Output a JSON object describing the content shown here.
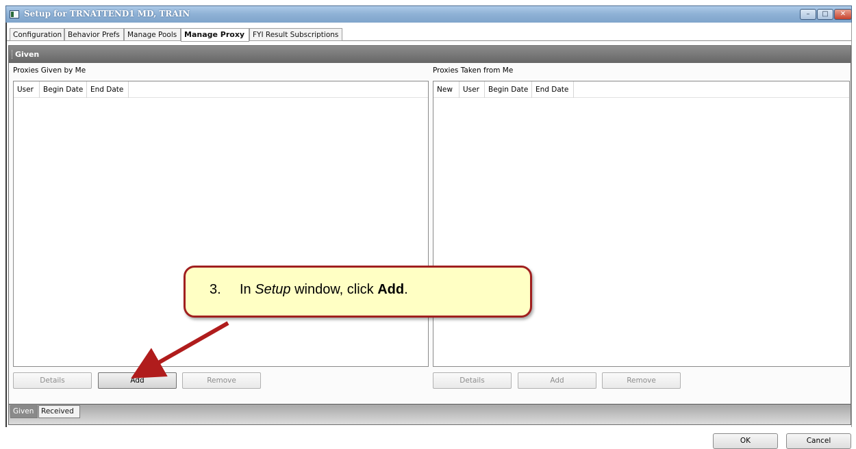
{
  "window": {
    "title": "Setup for TRNATTEND1 MD, TRAIN",
    "min_glyph": "–",
    "max_glyph": "□",
    "close_glyph": "✕"
  },
  "tabs": [
    {
      "label": "Configuration",
      "active": false
    },
    {
      "label": "Behavior Prefs",
      "active": false
    },
    {
      "label": "Manage Pools",
      "active": false
    },
    {
      "label": "Manage Proxy",
      "active": true
    },
    {
      "label": "FYI Result Subscriptions",
      "active": false
    }
  ],
  "section": {
    "title": "Given"
  },
  "given_pane": {
    "label": "Proxies Given by Me",
    "columns": [
      "User",
      "Begin Date",
      "End Date"
    ],
    "rows": [],
    "buttons": {
      "details": "Details",
      "add": "Add",
      "remove": "Remove"
    }
  },
  "taken_pane": {
    "label": "Proxies Taken from Me",
    "columns": [
      "New",
      "User",
      "Begin Date",
      "End Date"
    ],
    "rows": [],
    "buttons": {
      "details": "Details",
      "add": "Add",
      "remove": "Remove"
    }
  },
  "bottom_tabs": [
    {
      "label": "Given",
      "active": true
    },
    {
      "label": "Received",
      "active": false
    }
  ],
  "dialog": {
    "ok": "OK",
    "cancel": "Cancel"
  },
  "callout": {
    "number": "3.",
    "text_before": "In ",
    "italic": "Setup",
    "text_middle": " window, click ",
    "bold": "Add",
    "text_after": "."
  },
  "colors": {
    "callout_border": "#a01f1f",
    "callout_fill": "#ffffc4",
    "arrow": "#b01c1c"
  }
}
